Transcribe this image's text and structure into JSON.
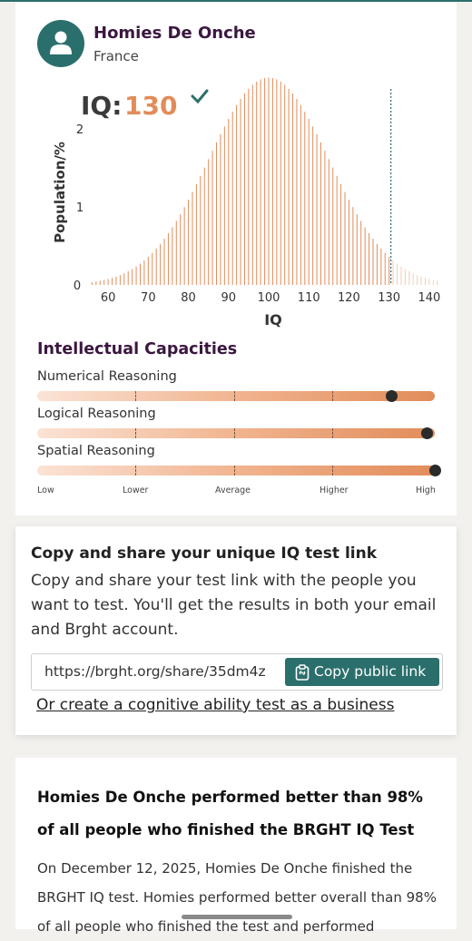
{
  "profile": {
    "name": "Homies De Onche",
    "country": "France",
    "iq_label": "IQ:",
    "iq_value": "130"
  },
  "chart_data": {
    "type": "bar",
    "title": "",
    "xlabel": "IQ",
    "ylabel": "Population/%",
    "x_range": [
      55,
      145
    ],
    "ylim": [
      0,
      2.7
    ],
    "x_ticks": [
      60,
      70,
      80,
      90,
      100,
      110,
      120,
      130,
      140
    ],
    "y_ticks": [
      0,
      1,
      2
    ],
    "distribution": {
      "mean": 100,
      "sd": 15,
      "bin_width": 1
    },
    "marker_value": 130,
    "colors": {
      "below_marker": "#e28c5a",
      "above_marker": "#f3cdb7",
      "marker_line": "#2b6f6c"
    }
  },
  "capacities": {
    "title": "Intellectual Capacities",
    "items": [
      {
        "label": "Numerical Reasoning",
        "level": 0.89
      },
      {
        "label": "Logical Reasoning",
        "level": 0.98
      },
      {
        "label": "Spatial Reasoning",
        "level": 1.0
      }
    ],
    "levels": [
      "Low",
      "Lower",
      "Average",
      "Higher",
      "High"
    ]
  },
  "share": {
    "title": "Copy and share your unique IQ test link",
    "description": "Copy and share your test link with the people you want to test. You'll get the results in both your email and Brght account.",
    "link": "https://brght.org/share/35dm4z",
    "copy_button": "Copy public link",
    "business_link": "Or create a cognitive ability test as a business"
  },
  "performance": {
    "title": "Homies De Onche performed better than 98% of all people who finished the BRGHT IQ Test",
    "body": "On December 12, 2025, Homies De Onche finished the BRGHT IQ test. Homies performed better overall than 98% of all people who finished the test and performed"
  },
  "icons": {
    "avatar": "user-icon",
    "verified": "check-icon",
    "copy": "clipboard-link-icon"
  }
}
